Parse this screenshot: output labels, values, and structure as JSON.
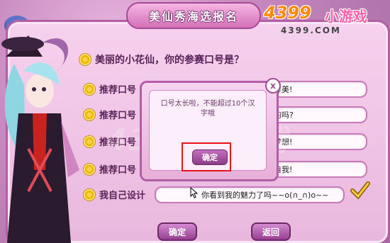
{
  "title": "美仙秀海选报名",
  "brand": {
    "number": "4399",
    "game": "小游戏",
    "url": "4399.COM"
  },
  "question": "美丽的小花仙，你的参赛口号是？",
  "rows": [
    {
      "label": "推荐口号",
      "value": "样美!"
    },
    {
      "label": "推荐口号",
      "value": "的吗?"
    },
    {
      "label": "推荐口号",
      "value": "梦想!"
    },
    {
      "label": "推荐口号",
      "value": "自我!"
    }
  ],
  "custom": {
    "label": "我自己设计",
    "value": "你看到我的魅力了吗~~o(∩_∩)o~~"
  },
  "dialog": {
    "message": "口号太长啦，不能超过10个汉字哦",
    "ok": "确定",
    "close": "x"
  },
  "buttons": {
    "confirm": "确定",
    "back": "返回"
  },
  "watermark": "4399小游戏"
}
